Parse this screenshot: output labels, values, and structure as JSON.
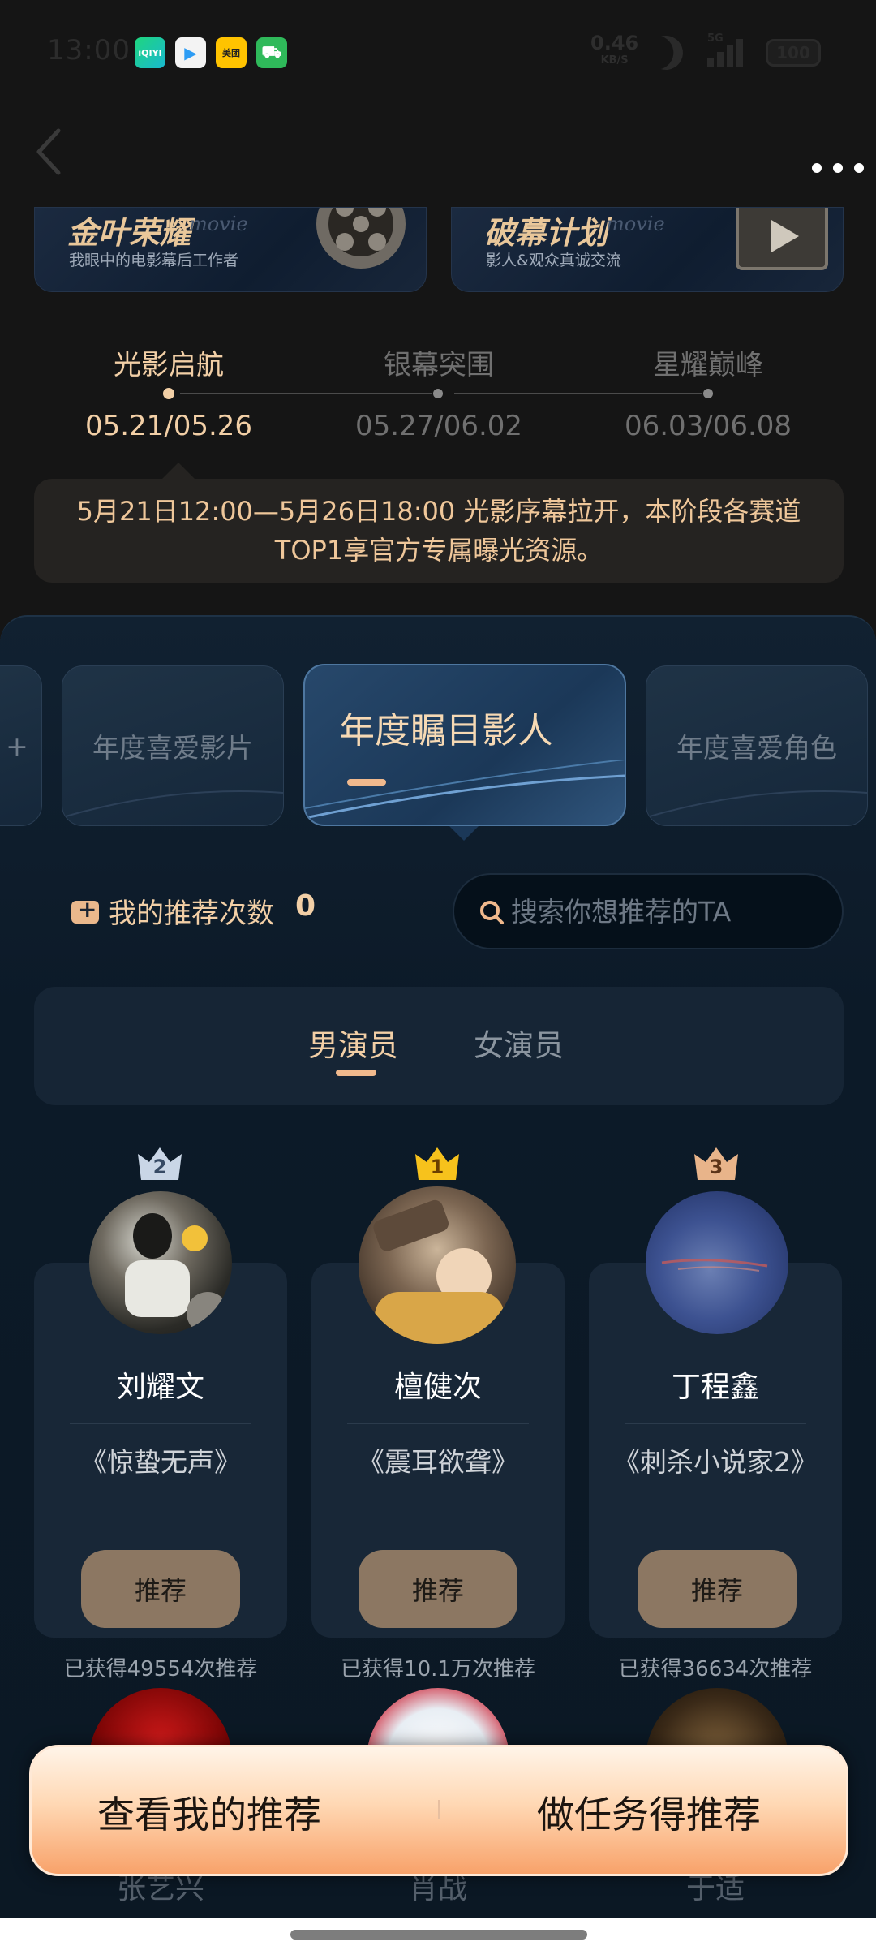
{
  "status_bar": {
    "time": "13:00",
    "apps": [
      {
        "icon": "iqiyi-icon",
        "label": "iQIYI",
        "color": "#1fc87c"
      },
      {
        "icon": "tencent-video-icon",
        "label": "▶",
        "color": "#2d9cf4"
      },
      {
        "icon": "meituan-icon",
        "label": "美团",
        "color": "#ffc300"
      },
      {
        "icon": "shopping-bag-icon",
        "label": "⛟",
        "color": "#2fb95a"
      }
    ],
    "net_speed": "0.46",
    "net_unit": "KB/S",
    "network": "5G",
    "battery": "100"
  },
  "banners": [
    {
      "title": "金叶荣耀",
      "tag": "movie",
      "subtitle": "我眼中的电影幕后工作者"
    },
    {
      "title": "破幕计划",
      "tag": "movie",
      "subtitle": "影人&观众真诚交流"
    }
  ],
  "stages": [
    {
      "name": "光影启航",
      "dates": "05.21/05.26",
      "active": true
    },
    {
      "name": "银幕突围",
      "dates": "05.27/06.02",
      "active": false
    },
    {
      "name": "星耀巅峰",
      "dates": "06.03/06.08",
      "active": false
    }
  ],
  "notice": {
    "line1": "5月21日12:00—5月26日18:00 光影序幕拉开，本阶段各赛道",
    "line2": "TOP1享官方专属曝光资源。"
  },
  "categories": {
    "partial_left": "+",
    "items": [
      "年度喜爱影片",
      "年度瞩目影人",
      "年度喜爱角色"
    ],
    "active_index": 1
  },
  "recommend": {
    "label": "我的推荐次数",
    "count": "0"
  },
  "search": {
    "placeholder": "搜索你想推荐的TA"
  },
  "gender_tabs": {
    "male": "男演员",
    "female": "女演员",
    "active": "male"
  },
  "candidates": [
    {
      "rank": "2",
      "name": "刘耀文",
      "movie": "《惊蛰无声》",
      "button": "推荐",
      "votes": "已获得49554次推荐"
    },
    {
      "rank": "1",
      "name": "檀健次",
      "movie": "《震耳欲聋》",
      "button": "推荐",
      "votes": "已获得10.1万次推荐"
    },
    {
      "rank": "3",
      "name": "丁程鑫",
      "movie": "《刺杀小说家2》",
      "button": "推荐",
      "votes": "已获得36634次推荐"
    }
  ],
  "next_row": [
    "张艺兴",
    "肖战",
    "于适"
  ],
  "bottom_actions": {
    "view": "查看我的推荐",
    "task": "做任务得推荐"
  },
  "colors": {
    "accent": "#f0b98d",
    "gold": "#f2cfa6",
    "panel": "#112131",
    "button": "#8c7762"
  }
}
